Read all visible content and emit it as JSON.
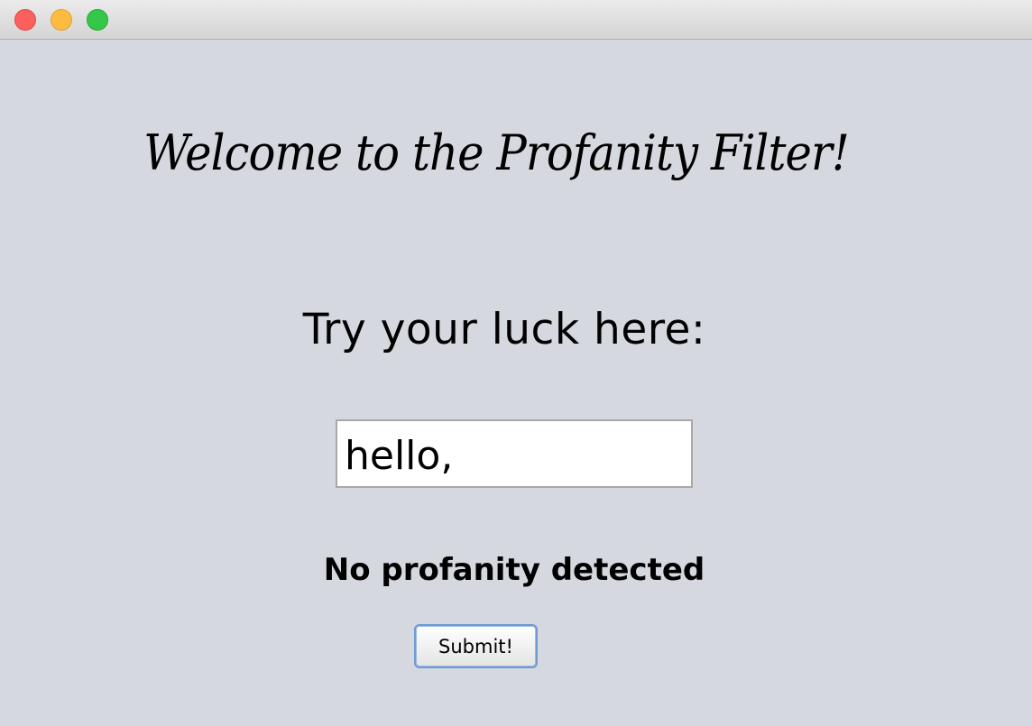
{
  "window": {
    "controls": {
      "close": "close-button",
      "minimize": "minimize-button",
      "maximize": "maximize-button"
    }
  },
  "main": {
    "heading": "Welcome to the Profanity Filter!",
    "prompt": "Try your luck here:",
    "input_value": "hello,",
    "status": "No profanity detected",
    "submit_label": "Submit!"
  },
  "colors": {
    "background": "#d6d8e0",
    "close": "#fc605c",
    "minimize": "#fdbc40",
    "maximize": "#34c84a",
    "button_focus": "#6f9ad3"
  }
}
